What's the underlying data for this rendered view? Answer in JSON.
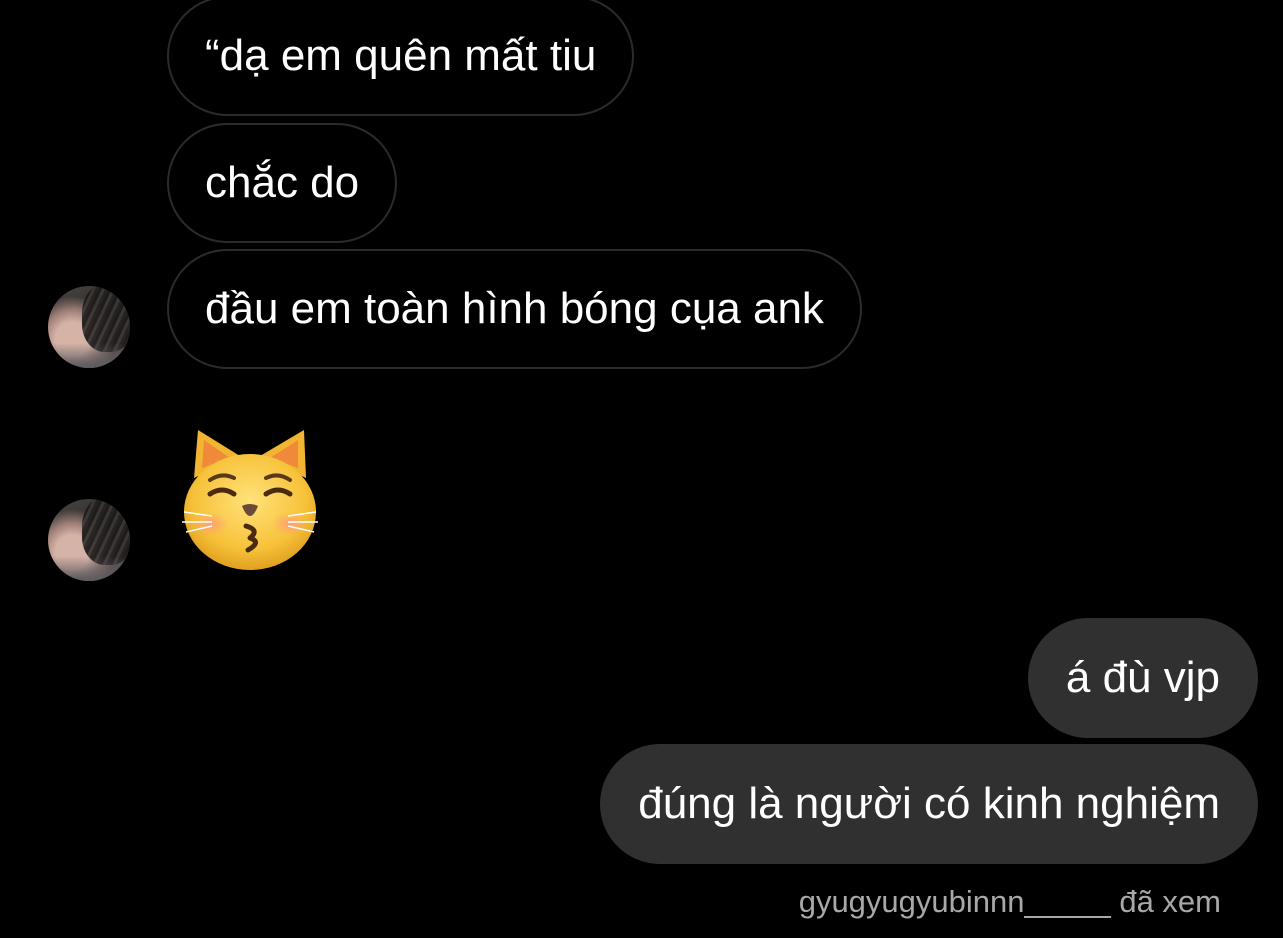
{
  "messages": {
    "incoming": [
      {
        "text": "“dạ em quên mất tiu"
      },
      {
        "text": "chắc do"
      },
      {
        "text": "đầu em toàn hình bóng cụa ank"
      }
    ],
    "sticker": {
      "icon": "kissing-cat-emoji"
    },
    "outgoing": [
      {
        "text": "á đù vjp"
      },
      {
        "text": "đúng là người có kinh nghiệm"
      }
    ]
  },
  "seen_status": {
    "username": "gyugyugyubinnn_____",
    "label": "đã xem"
  },
  "colors": {
    "background": "#000000",
    "outgoing_bubble": "#303030",
    "incoming_border": "#2b2b2b",
    "seen_text": "#a8a8a8"
  }
}
